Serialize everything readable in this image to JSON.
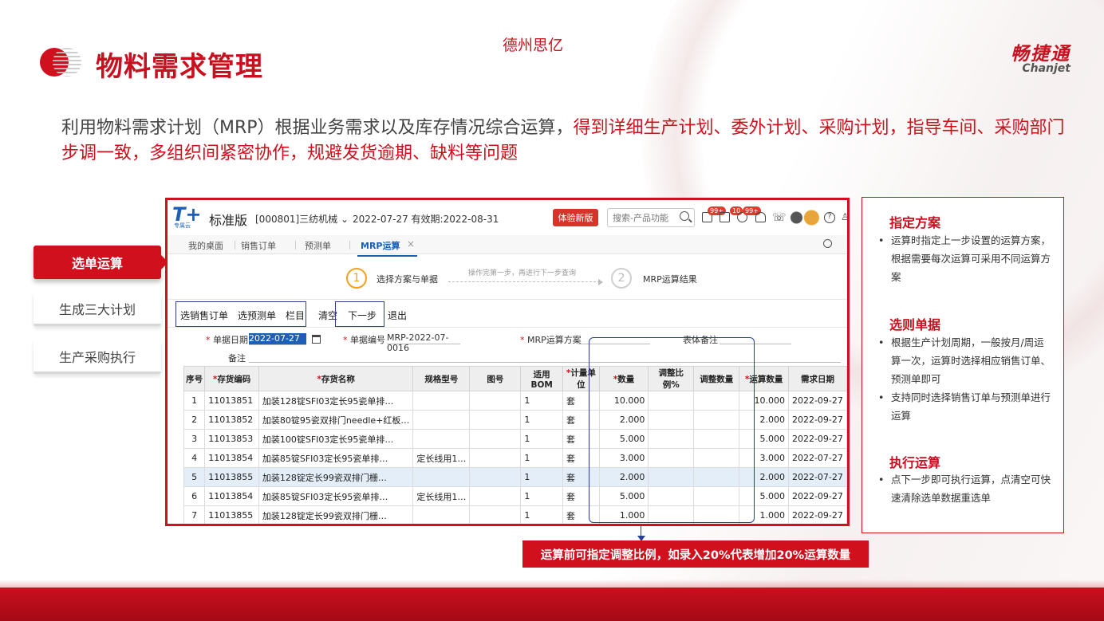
{
  "header": {
    "title": "物料需求管理",
    "company": "德州思亿",
    "brand_cn": "畅捷通",
    "brand_en": "Chanjet"
  },
  "intro": {
    "normal": "利用物料需求计划（MRP）根据业务需求以及库存情况综合运算，",
    "highlight": "得到详细生产计划、委外计划、采购计划，指导车间、采购部门步调一致，多组织间紧密协作，规避发货逾期、缺料等问题"
  },
  "sidebar": {
    "items": [
      {
        "label": "选单运算",
        "active": true
      },
      {
        "label": "生成三大计划",
        "active": false
      },
      {
        "label": "生产采购执行",
        "active": false
      }
    ]
  },
  "app": {
    "logo": "T+",
    "logo_sub": "专属云",
    "edition": "标准版",
    "org": "[000801]三纺机械 ⌄",
    "date": "2022-07-27  有效期:2022-08-31",
    "trial_button": "体验新版",
    "search_placeholder": "搜索-产品功能",
    "badges": [
      "99+",
      "10",
      "99+"
    ],
    "tabs": [
      "我的桌面",
      "销售订单",
      "预测单",
      "MRP运算"
    ],
    "tab_close": "×",
    "steps": {
      "step1_num": "1",
      "step1_label": "选择方案与单据",
      "hint": "操作完第一步，再进行下一步查询",
      "step2_num": "2",
      "step2_label": "MRP运算结果"
    },
    "toolbar": [
      "选销售订单",
      "选预测单",
      "栏目",
      "清空",
      "下一步",
      "退出"
    ],
    "form": {
      "date_label": "单据日期",
      "date_value": "2022-07-27",
      "code_label": "单据编号",
      "code_value": "MRP-2022-07-0016",
      "scheme_label": "MRP运算方案",
      "remark_label": "表体备注",
      "note_label": "备注"
    },
    "table": {
      "headers": [
        "序号",
        "存货编码",
        "存货名称",
        "规格型号",
        "图号",
        "适用BOM",
        "计量单位",
        "数量",
        "调整比例%",
        "调整数量",
        "运算数量",
        "需求日期"
      ],
      "required": [
        false,
        true,
        true,
        false,
        false,
        false,
        true,
        true,
        false,
        false,
        true,
        false
      ],
      "rows": [
        [
          "1",
          "11013851",
          "加装128锭SFI03定长95瓷单排…",
          "",
          "",
          "1",
          "套",
          "10.000",
          "",
          "",
          "10.000",
          "2022-09-27"
        ],
        [
          "2",
          "11013852",
          "加装80锭95瓷双排门needle+红板…",
          "",
          "",
          "1",
          "套",
          "2.000",
          "",
          "",
          "2.000",
          "2022-09-27"
        ],
        [
          "3",
          "11013853",
          "加装100锭SFI03定长95瓷单排…",
          "",
          "",
          "1",
          "套",
          "5.000",
          "",
          "",
          "5.000",
          "2022-09-27"
        ],
        [
          "4",
          "11013854",
          "加装85锭SFI03定长95瓷单排…",
          "定长线用1…",
          "",
          "1",
          "套",
          "3.000",
          "",
          "",
          "3.000",
          "2022-07-27"
        ],
        [
          "5",
          "11013855",
          "加装128锭定长99瓷双排门栅…",
          "",
          "",
          "1",
          "套",
          "2.000",
          "",
          "",
          "2.000",
          "2022-07-27"
        ],
        [
          "6",
          "11013854",
          "加装85锭SFI03定长95瓷单排…",
          "定长线用1…",
          "",
          "1",
          "套",
          "5.000",
          "",
          "",
          "5.000",
          "2022-09-27"
        ],
        [
          "7",
          "11013855",
          "加装128锭定长99瓷双排门栅…",
          "",
          "",
          "1",
          "套",
          "1.000",
          "",
          "",
          "1.000",
          "2022-09-27"
        ]
      ]
    }
  },
  "callout": "运算前可指定调整比例，如录入20%代表增加20%运算数量",
  "right_panel": {
    "sections": [
      {
        "title": "指定方案",
        "items": [
          "运算时指定上一步设置的运算方案，根据需要每次运算可采用不同运算方案"
        ]
      },
      {
        "title": "选则单据",
        "items": [
          "根据生产计划周期，一般按月/周运算一次，运算时选择相应销售订单、预测单即可",
          "支持同时选择销售订单与预测单进行运算"
        ]
      },
      {
        "title": "执行运算",
        "items": [
          "点下一步即可执行运算，点清空可快速清除选单数据重选单"
        ]
      }
    ]
  },
  "colors": {
    "brand_red": "#d0101d",
    "link_blue": "#1d5fb5",
    "highlight_box": "#2a3f8f",
    "step_active": "#f5a020"
  }
}
